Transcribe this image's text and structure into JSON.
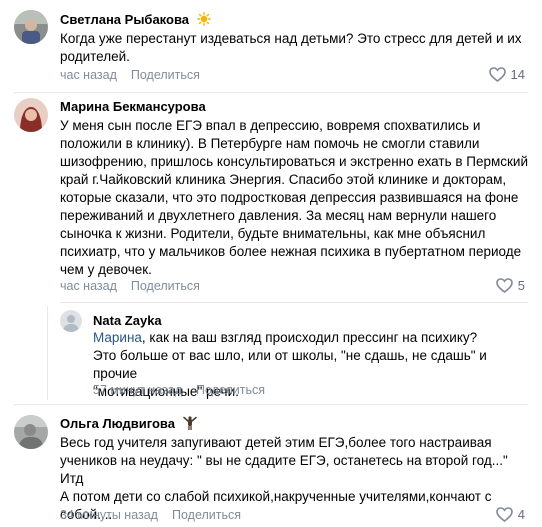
{
  "comments": [
    {
      "author": "Светлана Рыбакова",
      "text": "Когда уже перестанут издеваться над детьми? Это стресс для детей и их\nродителей.",
      "time": "час назад",
      "share_label": "Поделиться",
      "likes": "14"
    },
    {
      "author": "Марина Бекмансурова",
      "text": "У меня сын после ЕГЭ впал в депрессию, вовремя спохватились и\nположили в клинику). В Петербурге нам помочь не смогли ставили\nшизофрению, пришлось консультироваться и экстренно ехать в Пермский\nкрай г.Чайковский клиника Энергия. Спасибо этой клинике и докторам,\nкоторые сказали, что это подростковая депрессия развившаяся на фоне\nпереживаний и двухлетнего давления. За месяц нам вернули нашего\nсыночка к жизни. Родители, будьте внимательны, как мне объяснил\nпсихиатр, что у мальчиков более нежная психика в пубертатном периоде\nчем у девочек.",
      "time": "час назад",
      "share_label": "Поделиться",
      "likes": "5"
    },
    {
      "author": "Nata Zayka",
      "reply_to": "Марина",
      "text": ", как на ваш взгляд происходил прессинг на психику?\nЭто больше от вас шло, или от школы, \"не сдашь, не сдашь\" и прочие\n\"мотивационные\" речи.",
      "time": "57 минут назад",
      "share_label": "Поделиться"
    },
    {
      "author": "Ольга Людвигова",
      "text": "Весь год учителя запугивают детей этим ЕГЭ,более того настраивая\nучеников на неудачу: \" вы не сдадите ЕГЭ, останетесь на второй год...\" Итд\nА потом дети со слабой психикой,накрученные учителями,кончают с\nсобой....",
      "time": "34 минуты назад",
      "share_label": "Поделиться",
      "likes": "4"
    }
  ],
  "colors": {
    "link": "#2a5885",
    "meta": "#818c99",
    "divider": "#e7e8ec"
  },
  "icons": [
    "sun-icon",
    "heart-icon",
    "gesture-icon"
  ]
}
